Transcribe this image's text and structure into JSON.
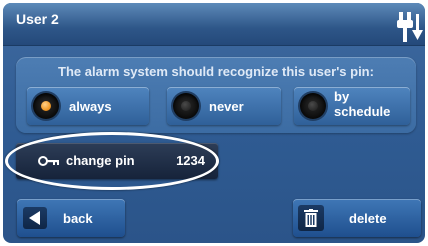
{
  "header": {
    "title": "User 2",
    "status_icon": "plug-icon"
  },
  "recognition": {
    "prompt": "The alarm system should recognize this user's pin:",
    "options": [
      {
        "label": "always",
        "selected": true
      },
      {
        "label": "never",
        "selected": false
      },
      {
        "label": "by schedule",
        "selected": false
      }
    ]
  },
  "pin": {
    "icon": "key-icon",
    "label": "change pin",
    "value": "1234"
  },
  "footer": {
    "back_label": "back",
    "back_icon": "arrow-left-icon",
    "delete_label": "delete",
    "delete_icon": "trash-icon"
  },
  "colors": {
    "selected_indicator": "#f09a28",
    "highlight_ring": "#ffffff",
    "background": "#2f5b92"
  }
}
